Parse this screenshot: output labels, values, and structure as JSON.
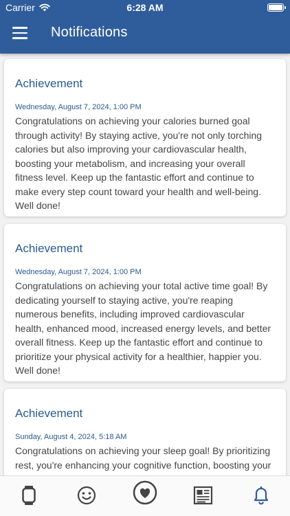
{
  "status": {
    "carrier": "Carrier",
    "time": "6:28 AM"
  },
  "header": {
    "title": "Notifications",
    "menu_icon": "hamburger-menu-icon"
  },
  "notifications": [
    {
      "title": "Achievement",
      "date": "Wednesday, August 7, 2024, 1:00 PM",
      "body": "Congratulations on achieving your calories burned goal through activity! By staying active, you're not only torching calories but also improving your cardiovascular health, boosting your metabolism, and increasing your overall fitness level. Keep up the fantastic effort and continue to make every step count toward your health and well-being. Well done!"
    },
    {
      "title": "Achievement",
      "date": "Wednesday, August 7, 2024, 1:00 PM",
      "body": "Congratulations on achieving your total active time goal! By dedicating yourself to staying active, you're reaping numerous benefits, including improved cardiovascular health, enhanced mood, increased energy levels, and better overall fitness. Keep up the fantastic effort and continue to prioritize your physical activity for a healthier, happier you. Well done!"
    },
    {
      "title": "Achievement",
      "date": "Sunday, August 4, 2024, 5:18 AM",
      "body": "Congratulations on achieving your sleep goal! By prioritizing rest, you're enhancing your cognitive function, boosting your immune system, and promoting overall"
    }
  ],
  "tabbar": {
    "tabs": [
      {
        "icon": "watch-icon"
      },
      {
        "icon": "smiley-face-icon"
      },
      {
        "icon": "heart-icon"
      },
      {
        "icon": "newspaper-icon"
      },
      {
        "icon": "bell-icon"
      }
    ]
  },
  "colors": {
    "header": "#2f5d9b",
    "title_text": "#2a5a8e",
    "icon": "#444444"
  }
}
